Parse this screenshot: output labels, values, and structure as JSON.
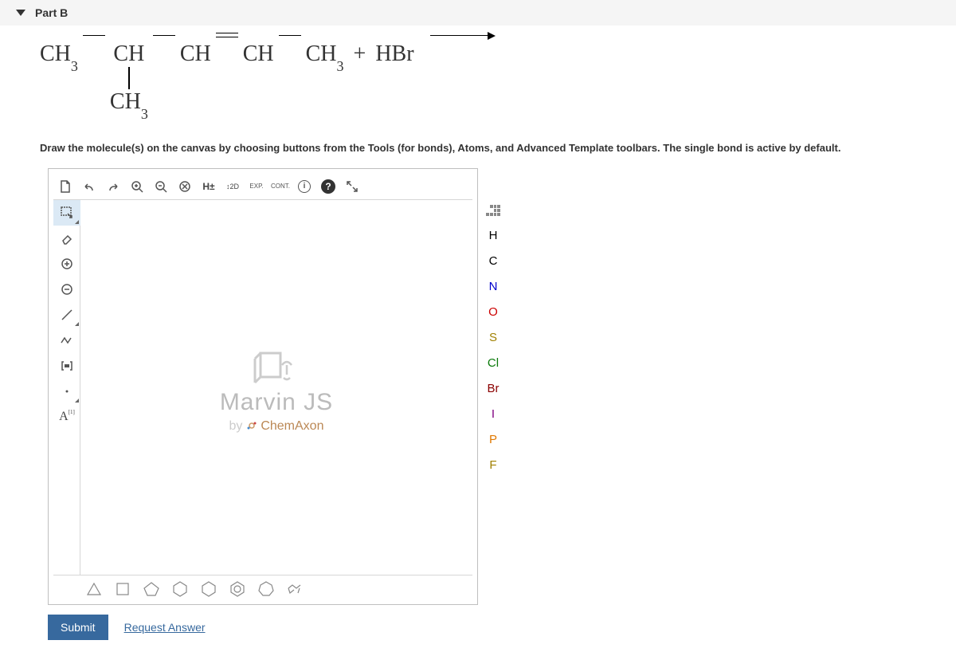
{
  "header": {
    "part_label": "Part B"
  },
  "reaction": {
    "r1": "CH",
    "s1": "3",
    "r2": "CH",
    "r3": "CH",
    "r4": "CH",
    "r5": "CH",
    "s5": "3",
    "plus": "+",
    "hbr": "HBr",
    "branch": "CH",
    "branch_sub": "3"
  },
  "instructions": "Draw the molecule(s) on the canvas by choosing buttons from the Tools (for bonds), Atoms, and Advanced Template toolbars. The single bond is active by default.",
  "top_toolbar": {
    "hpm": "H±",
    "twod": "2D",
    "exp": "EXP.",
    "cont": "CONT."
  },
  "left_toolbar": {
    "a_label": "A",
    "a_sup": "[1]"
  },
  "canvas": {
    "logo": "Marvin JS",
    "by": "by",
    "brand": "ChemAxon"
  },
  "atoms": {
    "h": "H",
    "c": "C",
    "n": "N",
    "o": "O",
    "s": "S",
    "cl": "Cl",
    "br": "Br",
    "i": "I",
    "p": "P",
    "f": "F"
  },
  "actions": {
    "submit": "Submit",
    "request": "Request Answer"
  }
}
